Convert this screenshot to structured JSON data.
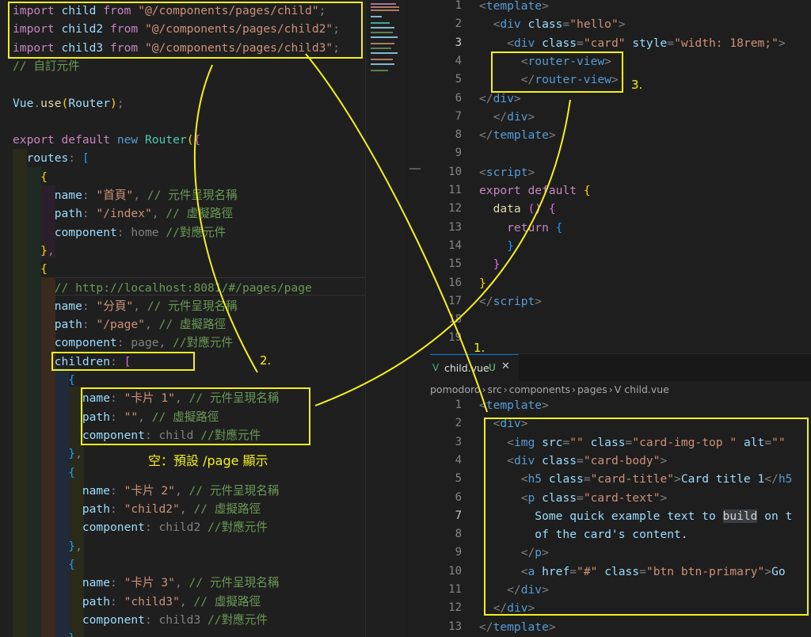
{
  "left_editor": {
    "lines": [
      {
        "t": [
          [
            "kw",
            "import"
          ],
          [
            "var",
            " child "
          ],
          [
            "kw",
            "from "
          ],
          [
            "str",
            "\"@/components/pages/child\""
          ],
          [
            "pn",
            ";"
          ]
        ]
      },
      {
        "t": [
          [
            "kw",
            "import"
          ],
          [
            "var",
            " child2 "
          ],
          [
            "kw",
            "from "
          ],
          [
            "str",
            "\"@/components/pages/child2\""
          ],
          [
            "pn",
            ";"
          ]
        ]
      },
      {
        "t": [
          [
            "kw",
            "import"
          ],
          [
            "var",
            " child3 "
          ],
          [
            "kw",
            "from "
          ],
          [
            "str",
            "\"@/components/pages/child3\""
          ],
          [
            "pn",
            ";"
          ]
        ]
      },
      {
        "t": [
          [
            "cm",
            "// 自訂元件"
          ]
        ]
      },
      {
        "t": []
      },
      {
        "t": [
          [
            "var",
            "Vue"
          ],
          [
            "pn",
            "."
          ],
          [
            "fn",
            "use"
          ],
          [
            "br",
            "("
          ],
          [
            "var",
            "Router"
          ],
          [
            "br",
            ")"
          ],
          [
            "pn",
            ";"
          ]
        ]
      },
      {
        "t": []
      },
      {
        "t": [
          [
            "kw",
            "export "
          ],
          [
            "kw",
            "default "
          ],
          [
            "kwb",
            "new "
          ],
          [
            "cls",
            "Router"
          ],
          [
            "br",
            "("
          ],
          [
            "br2",
            "{"
          ]
        ]
      },
      {
        "t": [
          [
            "var",
            "  routes"
          ],
          [
            "pn",
            ": "
          ],
          [
            "br3",
            "["
          ]
        ]
      },
      {
        "t": [
          [
            "br",
            "    {"
          ]
        ]
      },
      {
        "t": [
          [
            "var",
            "      name"
          ],
          [
            "pn",
            ": "
          ],
          [
            "str",
            "\"首頁\""
          ],
          [
            "pn",
            ", "
          ],
          [
            "cm",
            "// 元件呈現名稱"
          ]
        ]
      },
      {
        "t": [
          [
            "var",
            "      path"
          ],
          [
            "pn",
            ": "
          ],
          [
            "str",
            "\"/index\""
          ],
          [
            "pn",
            ", "
          ],
          [
            "cm",
            "// 虛擬路徑"
          ]
        ]
      },
      {
        "t": [
          [
            "var",
            "      component"
          ],
          [
            "pn",
            ": home "
          ],
          [
            "cm",
            "//對應元件"
          ]
        ]
      },
      {
        "t": [
          [
            "br",
            "    }"
          ],
          [
            "pn",
            ","
          ]
        ]
      },
      {
        "t": [
          [
            "br",
            "    {"
          ]
        ]
      },
      {
        "t": [
          [
            "cm",
            "      // http://localhost:8081/#/pages/page"
          ]
        ]
      },
      {
        "t": [
          [
            "var",
            "      name"
          ],
          [
            "pn",
            ": "
          ],
          [
            "str",
            "\"分頁\""
          ],
          [
            "pn",
            ", "
          ],
          [
            "cm",
            "// 元件呈現名稱"
          ]
        ]
      },
      {
        "t": [
          [
            "var",
            "      path"
          ],
          [
            "pn",
            ": "
          ],
          [
            "str",
            "\"/page\""
          ],
          [
            "pn",
            ", "
          ],
          [
            "cm",
            "// 虛擬路徑"
          ]
        ]
      },
      {
        "t": [
          [
            "var",
            "      component"
          ],
          [
            "pn",
            ": page, "
          ],
          [
            "cm",
            "//對應元件"
          ]
        ]
      },
      {
        "t": [
          [
            "var",
            "      children"
          ],
          [
            "pn",
            ": "
          ],
          [
            "br2",
            "["
          ]
        ]
      },
      {
        "t": [
          [
            "br3",
            "        {"
          ]
        ]
      },
      {
        "t": [
          [
            "var",
            "          name"
          ],
          [
            "pn",
            ": "
          ],
          [
            "str",
            "\"卡片 1\""
          ],
          [
            "pn",
            ", "
          ],
          [
            "cm",
            "// 元件呈現名稱"
          ]
        ]
      },
      {
        "t": [
          [
            "var",
            "          path"
          ],
          [
            "pn",
            ": "
          ],
          [
            "str",
            "\"\""
          ],
          [
            "pn",
            ", "
          ],
          [
            "cm",
            "// 虛擬路徑"
          ]
        ]
      },
      {
        "t": [
          [
            "var",
            "          component"
          ],
          [
            "pn",
            ": child "
          ],
          [
            "cm",
            "//對應元件"
          ]
        ]
      },
      {
        "t": [
          [
            "br3",
            "        }"
          ],
          [
            "pn",
            ","
          ]
        ]
      },
      {
        "t": [
          [
            "br3",
            "        {"
          ]
        ]
      },
      {
        "t": [
          [
            "var",
            "          name"
          ],
          [
            "pn",
            ": "
          ],
          [
            "str",
            "\"卡片 2\""
          ],
          [
            "pn",
            ", "
          ],
          [
            "cm",
            "// 元件呈現名稱"
          ]
        ]
      },
      {
        "t": [
          [
            "var",
            "          path"
          ],
          [
            "pn",
            ": "
          ],
          [
            "str",
            "\"child2\""
          ],
          [
            "pn",
            ", "
          ],
          [
            "cm",
            "// 虛擬路徑"
          ]
        ]
      },
      {
        "t": [
          [
            "var",
            "          component"
          ],
          [
            "pn",
            ": child2 "
          ],
          [
            "cm",
            "//對應元件"
          ]
        ]
      },
      {
        "t": [
          [
            "br3",
            "        }"
          ],
          [
            "pn",
            ","
          ]
        ]
      },
      {
        "t": [
          [
            "br3",
            "        {"
          ]
        ]
      },
      {
        "t": [
          [
            "var",
            "          name"
          ],
          [
            "pn",
            ": "
          ],
          [
            "str",
            "\"卡片 3\""
          ],
          [
            "pn",
            ", "
          ],
          [
            "cm",
            "// 元件呈現名稱"
          ]
        ]
      },
      {
        "t": [
          [
            "var",
            "          path"
          ],
          [
            "pn",
            ": "
          ],
          [
            "str",
            "\"child3\""
          ],
          [
            "pn",
            ", "
          ],
          [
            "cm",
            "// 虛擬路徑"
          ]
        ]
      },
      {
        "t": [
          [
            "var",
            "          component"
          ],
          [
            "pn",
            ": child3 "
          ],
          [
            "cm",
            "//對應元件"
          ]
        ]
      },
      {
        "t": [
          [
            "br3",
            "        }"
          ]
        ]
      }
    ]
  },
  "top_right_editor": {
    "current_line": 3,
    "lines": [
      {
        "n": "1",
        "t": [
          [
            "pn",
            "<"
          ],
          [
            "tag",
            "template"
          ],
          [
            "pn",
            ">"
          ]
        ]
      },
      {
        "n": "2",
        "t": [
          [
            "pn",
            "  <"
          ],
          [
            "tag",
            "div "
          ],
          [
            "att",
            "class"
          ],
          [
            "pn",
            "="
          ],
          [
            "str",
            "\"hello\""
          ],
          [
            "pn",
            ">"
          ]
        ]
      },
      {
        "n": "3",
        "t": [
          [
            "pn",
            "    <"
          ],
          [
            "tag",
            "div "
          ],
          [
            "att",
            "class"
          ],
          [
            "pn",
            "="
          ],
          [
            "str",
            "\"card\" "
          ],
          [
            "att",
            "style"
          ],
          [
            "pn",
            "="
          ],
          [
            "str",
            "\"width: 18rem;\""
          ],
          [
            "pn",
            ">"
          ]
        ]
      },
      {
        "n": "4",
        "t": [
          [
            "pn",
            "      <"
          ],
          [
            "tag",
            "router-view"
          ],
          [
            "pn",
            ">"
          ]
        ]
      },
      {
        "n": "5",
        "t": [
          [
            "pn",
            "      </"
          ],
          [
            "tag",
            "router-view"
          ],
          [
            "pn",
            ">"
          ]
        ]
      },
      {
        "n": "6",
        "t": [
          [
            "pn",
            "</"
          ],
          [
            "tag",
            "div"
          ],
          [
            "pn",
            ">"
          ]
        ]
      },
      {
        "n": "7",
        "t": [
          [
            "pn",
            "  </"
          ],
          [
            "tag",
            "div"
          ],
          [
            "pn",
            ">"
          ]
        ]
      },
      {
        "n": "8",
        "t": [
          [
            "pn",
            "</"
          ],
          [
            "tag",
            "template"
          ],
          [
            "pn",
            ">"
          ]
        ]
      },
      {
        "n": "9",
        "t": []
      },
      {
        "n": "10",
        "t": [
          [
            "pn",
            "<"
          ],
          [
            "tag",
            "script"
          ],
          [
            "pn",
            ">"
          ]
        ]
      },
      {
        "n": "11",
        "t": [
          [
            "kw",
            "export "
          ],
          [
            "kw",
            "default "
          ],
          [
            "br",
            "{"
          ]
        ]
      },
      {
        "n": "12",
        "t": [
          [
            "fn",
            "  data "
          ],
          [
            "br2",
            "()"
          ],
          [
            "pn",
            " "
          ],
          [
            "br2",
            "{"
          ]
        ]
      },
      {
        "n": "13",
        "t": [
          [
            "kw",
            "    return "
          ],
          [
            "br3",
            "{"
          ]
        ]
      },
      {
        "n": "14",
        "t": [
          [
            "br3",
            "    }"
          ]
        ]
      },
      {
        "n": "15",
        "t": [
          [
            "br2",
            "  }"
          ]
        ]
      },
      {
        "n": "16",
        "t": [
          [
            "br",
            "}"
          ]
        ]
      },
      {
        "n": "17",
        "t": [
          [
            "pn",
            "</"
          ],
          [
            "tag",
            "script"
          ],
          [
            "pn",
            ">"
          ]
        ]
      },
      {
        "n": "18",
        "t": []
      },
      {
        "n": "19",
        "t": []
      }
    ]
  },
  "tab": {
    "icon": "V",
    "label": "child.vue",
    "badge": "U",
    "close": "✕"
  },
  "breadcrumbs": [
    "pomodoro",
    "›",
    "src",
    "›",
    "components",
    "›",
    "pages",
    "›",
    "V child.vue"
  ],
  "bottom_right_editor": {
    "current_line": 7,
    "lines": [
      {
        "n": "1",
        "t": [
          [
            "pn",
            "<"
          ],
          [
            "tag",
            "template"
          ],
          [
            "pn",
            ">"
          ]
        ]
      },
      {
        "n": "2",
        "t": [
          [
            "pn",
            "  <"
          ],
          [
            "tag",
            "div"
          ],
          [
            "pn",
            ">"
          ]
        ]
      },
      {
        "n": "3",
        "t": [
          [
            "pn",
            "    <"
          ],
          [
            "tag",
            "img "
          ],
          [
            "att",
            "src"
          ],
          [
            "pn",
            "="
          ],
          [
            "str",
            "\"\" "
          ],
          [
            "att",
            "class"
          ],
          [
            "pn",
            "="
          ],
          [
            "str",
            "\"card-img-top \" "
          ],
          [
            "att",
            "alt"
          ],
          [
            "pn",
            "="
          ],
          [
            "str",
            "\"\""
          ]
        ]
      },
      {
        "n": "4",
        "t": [
          [
            "pn",
            "    <"
          ],
          [
            "tag",
            "div "
          ],
          [
            "att",
            "class"
          ],
          [
            "pn",
            "="
          ],
          [
            "str",
            "\"card-body\""
          ],
          [
            "pn",
            ">"
          ]
        ]
      },
      {
        "n": "5",
        "t": [
          [
            "pn",
            "      <"
          ],
          [
            "tag",
            "h5 "
          ],
          [
            "att",
            "class"
          ],
          [
            "pn",
            "="
          ],
          [
            "str",
            "\"card-title\""
          ],
          [
            "pn",
            ">"
          ],
          [
            "var",
            "Card title 1"
          ],
          [
            "pn",
            "</"
          ],
          [
            "tag",
            "h5"
          ]
        ]
      },
      {
        "n": "6",
        "t": [
          [
            "pn",
            "      <"
          ],
          [
            "tag",
            "p "
          ],
          [
            "att",
            "class"
          ],
          [
            "pn",
            "="
          ],
          [
            "str",
            "\"card-text\""
          ],
          [
            "pn",
            ">"
          ]
        ]
      },
      {
        "n": "7",
        "t": [
          [
            "var",
            "        Some quick example text to "
          ],
          [
            "sel",
            "build"
          ],
          [
            "var",
            " on t"
          ]
        ]
      },
      {
        "n": "8",
        "t": [
          [
            "var",
            "        of the card's content."
          ]
        ]
      },
      {
        "n": "9",
        "t": [
          [
            "pn",
            "      </"
          ],
          [
            "tag",
            "p"
          ],
          [
            "pn",
            ">"
          ]
        ]
      },
      {
        "n": "10",
        "t": [
          [
            "pn",
            "      <"
          ],
          [
            "tag",
            "a "
          ],
          [
            "att",
            "href"
          ],
          [
            "pn",
            "="
          ],
          [
            "str",
            "\"#\" "
          ],
          [
            "att",
            "class"
          ],
          [
            "pn",
            "="
          ],
          [
            "str",
            "\"btn btn-primary\""
          ],
          [
            "pn",
            ">"
          ],
          [
            "var",
            "Go"
          ]
        ]
      },
      {
        "n": "11",
        "t": [
          [
            "pn",
            "    </"
          ],
          [
            "tag",
            "div"
          ],
          [
            "pn",
            ">"
          ]
        ]
      },
      {
        "n": "12",
        "t": [
          [
            "pn",
            "  </"
          ],
          [
            "tag",
            "div"
          ],
          [
            "pn",
            ">"
          ]
        ]
      },
      {
        "n": "13",
        "t": [
          [
            "pn",
            "</"
          ],
          [
            "tag",
            "template"
          ],
          [
            "pn",
            ">"
          ]
        ]
      }
    ]
  },
  "annotations": {
    "label_1": "1.",
    "label_2": "2.",
    "label_3": "3.",
    "note": "空：預設 /page 顯示"
  },
  "colors": {
    "annotation": "#f5f01e",
    "background": "#1e1e1e",
    "vue_green": "#41b883"
  }
}
